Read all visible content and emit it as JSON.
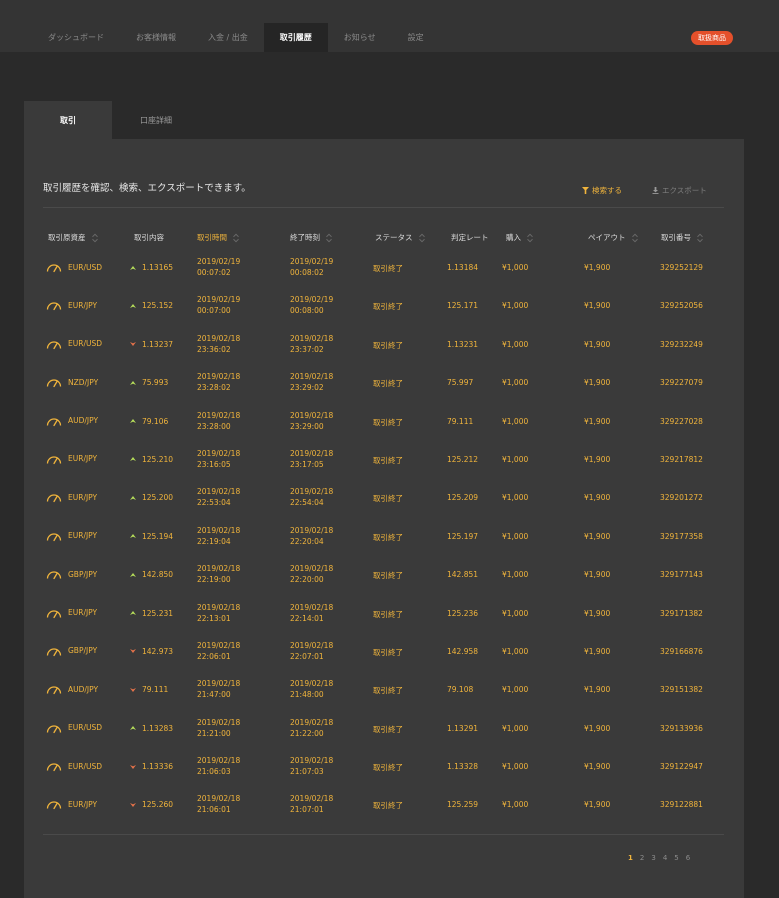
{
  "nav": {
    "items": [
      "ダッシュボード",
      "お客様情報",
      "入金 / 出金",
      "取引履歴",
      "お知らせ",
      "設定"
    ],
    "active_index": 3,
    "badge": "取扱商品"
  },
  "tabs": {
    "items": [
      "取引",
      "口座詳細"
    ],
    "active_index": 0
  },
  "panel": {
    "description": "取引履歴を確認、検索、エクスポートできます。",
    "search_label": "検索する",
    "export_label": "エクスポート"
  },
  "table": {
    "headers": [
      "取引原資産",
      "取引内容",
      "取引時間",
      "終了時刻",
      "ステータス",
      "判定レート",
      "購入",
      "ペイアウト",
      "取引番号"
    ],
    "active_header": 2,
    "rows": [
      {
        "asset": "EUR/USD",
        "dir": "up",
        "rate": "1.13165",
        "date": "2019/02/19",
        "time": "00:07:02",
        "end_date": "2019/02/19",
        "end_time": "00:08:02",
        "status": "取引終了",
        "judge": "1.13184",
        "buy": "¥1,000",
        "payout": "¥1,900",
        "id": "329252129"
      },
      {
        "asset": "EUR/JPY",
        "dir": "up",
        "rate": "125.152",
        "date": "2019/02/19",
        "time": "00:07:00",
        "end_date": "2019/02/19",
        "end_time": "00:08:00",
        "status": "取引終了",
        "judge": "125.171",
        "buy": "¥1,000",
        "payout": "¥1,900",
        "id": "329252056"
      },
      {
        "asset": "EUR/USD",
        "dir": "down",
        "rate": "1.13237",
        "date": "2019/02/18",
        "time": "23:36:02",
        "end_date": "2019/02/18",
        "end_time": "23:37:02",
        "status": "取引終了",
        "judge": "1.13231",
        "buy": "¥1,000",
        "payout": "¥1,900",
        "id": "329232249"
      },
      {
        "asset": "NZD/JPY",
        "dir": "up",
        "rate": "75.993",
        "date": "2019/02/18",
        "time": "23:28:02",
        "end_date": "2019/02/18",
        "end_time": "23:29:02",
        "status": "取引終了",
        "judge": "75.997",
        "buy": "¥1,000",
        "payout": "¥1,900",
        "id": "329227079"
      },
      {
        "asset": "AUD/JPY",
        "dir": "up",
        "rate": "79.106",
        "date": "2019/02/18",
        "time": "23:28:00",
        "end_date": "2019/02/18",
        "end_time": "23:29:00",
        "status": "取引終了",
        "judge": "79.111",
        "buy": "¥1,000",
        "payout": "¥1,900",
        "id": "329227028"
      },
      {
        "asset": "EUR/JPY",
        "dir": "up",
        "rate": "125.210",
        "date": "2019/02/18",
        "time": "23:16:05",
        "end_date": "2019/02/18",
        "end_time": "23:17:05",
        "status": "取引終了",
        "judge": "125.212",
        "buy": "¥1,000",
        "payout": "¥1,900",
        "id": "329217812"
      },
      {
        "asset": "EUR/JPY",
        "dir": "up",
        "rate": "125.200",
        "date": "2019/02/18",
        "time": "22:53:04",
        "end_date": "2019/02/18",
        "end_time": "22:54:04",
        "status": "取引終了",
        "judge": "125.209",
        "buy": "¥1,000",
        "payout": "¥1,900",
        "id": "329201272"
      },
      {
        "asset": "EUR/JPY",
        "dir": "up",
        "rate": "125.194",
        "date": "2019/02/18",
        "time": "22:19:04",
        "end_date": "2019/02/18",
        "end_time": "22:20:04",
        "status": "取引終了",
        "judge": "125.197",
        "buy": "¥1,000",
        "payout": "¥1,900",
        "id": "329177358"
      },
      {
        "asset": "GBP/JPY",
        "dir": "up",
        "rate": "142.850",
        "date": "2019/02/18",
        "time": "22:19:00",
        "end_date": "2019/02/18",
        "end_time": "22:20:00",
        "status": "取引終了",
        "judge": "142.851",
        "buy": "¥1,000",
        "payout": "¥1,900",
        "id": "329177143"
      },
      {
        "asset": "EUR/JPY",
        "dir": "up",
        "rate": "125.231",
        "date": "2019/02/18",
        "time": "22:13:01",
        "end_date": "2019/02/18",
        "end_time": "22:14:01",
        "status": "取引終了",
        "judge": "125.236",
        "buy": "¥1,000",
        "payout": "¥1,900",
        "id": "329171382"
      },
      {
        "asset": "GBP/JPY",
        "dir": "down",
        "rate": "142.973",
        "date": "2019/02/18",
        "time": "22:06:01",
        "end_date": "2019/02/18",
        "end_time": "22:07:01",
        "status": "取引終了",
        "judge": "142.958",
        "buy": "¥1,000",
        "payout": "¥1,900",
        "id": "329166876"
      },
      {
        "asset": "AUD/JPY",
        "dir": "down",
        "rate": "79.111",
        "date": "2019/02/18",
        "time": "21:47:00",
        "end_date": "2019/02/18",
        "end_time": "21:48:00",
        "status": "取引終了",
        "judge": "79.108",
        "buy": "¥1,000",
        "payout": "¥1,900",
        "id": "329151382"
      },
      {
        "asset": "EUR/USD",
        "dir": "up",
        "rate": "1.13283",
        "date": "2019/02/18",
        "time": "21:21:00",
        "end_date": "2019/02/18",
        "end_time": "21:22:00",
        "status": "取引終了",
        "judge": "1.13291",
        "buy": "¥1,000",
        "payout": "¥1,900",
        "id": "329133936"
      },
      {
        "asset": "EUR/USD",
        "dir": "down",
        "rate": "1.13336",
        "date": "2019/02/18",
        "time": "21:06:03",
        "end_date": "2019/02/18",
        "end_time": "21:07:03",
        "status": "取引終了",
        "judge": "1.13328",
        "buy": "¥1,000",
        "payout": "¥1,900",
        "id": "329122947"
      },
      {
        "asset": "EUR/JPY",
        "dir": "down",
        "rate": "125.260",
        "date": "2019/02/18",
        "time": "21:06:01",
        "end_date": "2019/02/18",
        "end_time": "21:07:01",
        "status": "取引終了",
        "judge": "125.259",
        "buy": "¥1,000",
        "payout": "¥1,900",
        "id": "329122881"
      }
    ]
  },
  "pagination": {
    "pages": [
      "1",
      "2",
      "3",
      "4",
      "5",
      "6"
    ],
    "active_index": 0
  },
  "colors": {
    "accent": "#f0b43c",
    "up": "#b8e05a",
    "down": "#e8734a",
    "badge": "#e4502b"
  }
}
